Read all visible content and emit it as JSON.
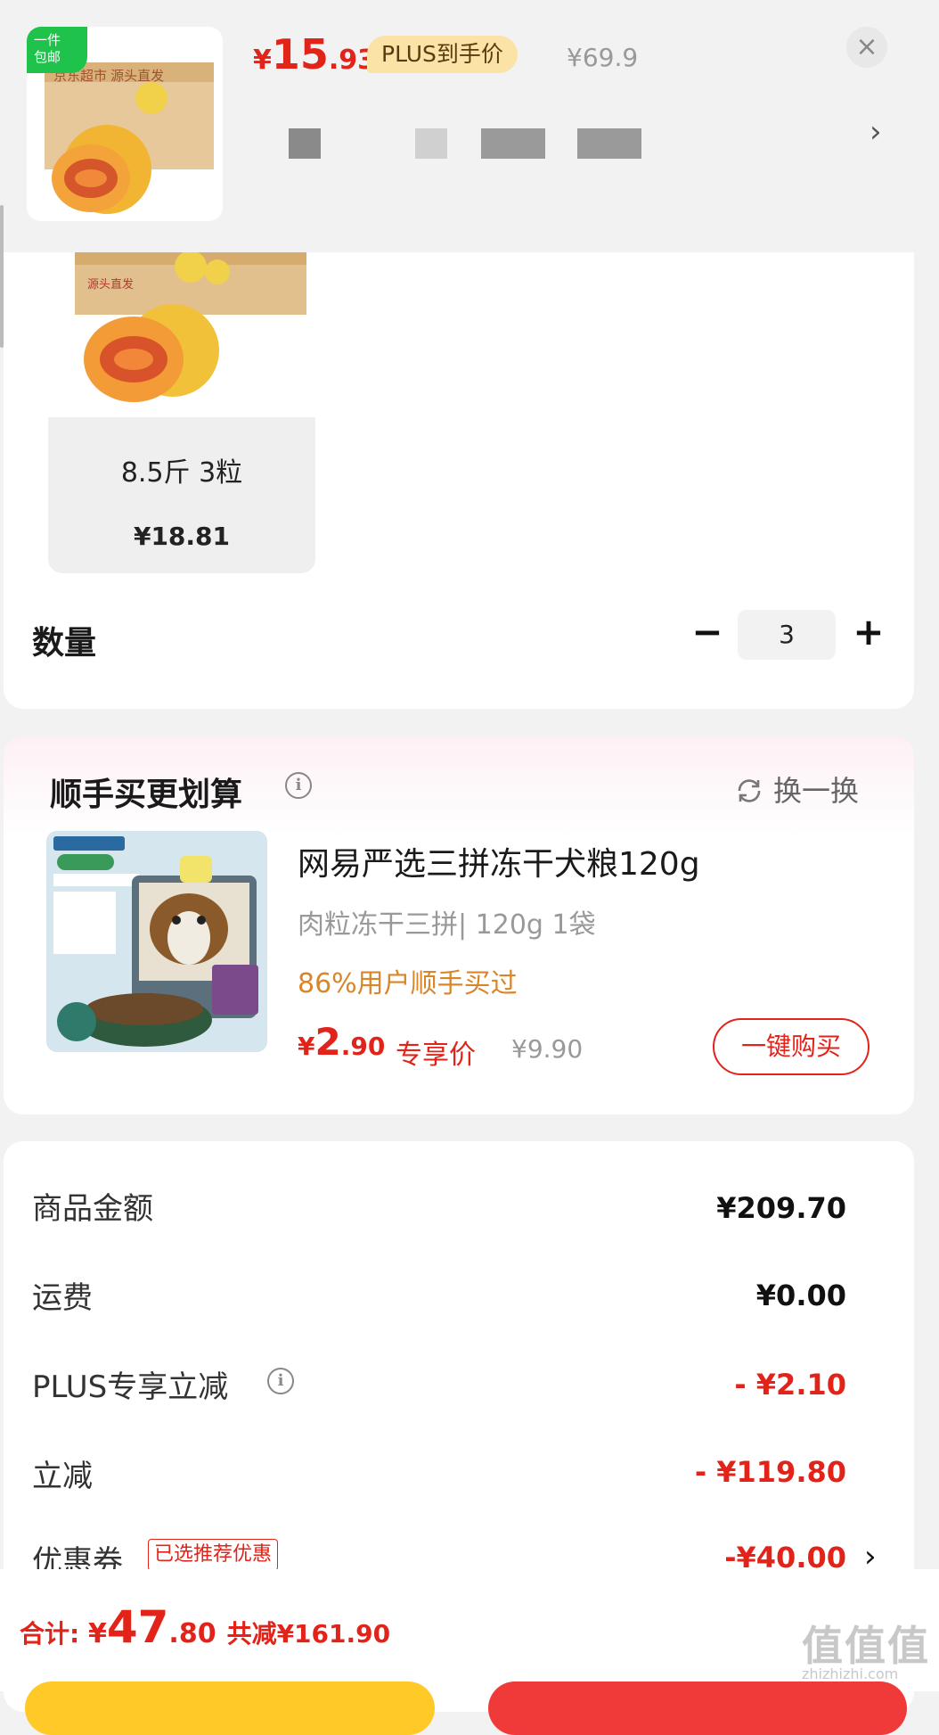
{
  "header": {
    "ribbon": "一件\n包邮",
    "price_currency": "¥",
    "price_int": "15",
    "price_dec": ".93",
    "plus_tag": "PLUS到手价",
    "original_price": "¥69.9",
    "close_icon": "×",
    "more_specs": "›"
  },
  "option": {
    "label": "8.5斤 3粒",
    "price": "¥18.81"
  },
  "quantity": {
    "label": "数量",
    "minus": "−",
    "value": "3",
    "plus": "+"
  },
  "recommend": {
    "title": "顺手买更划算",
    "info": "i",
    "swap": "换一换",
    "product_name": "网易严选三拼冻干犬粮120g",
    "product_spec": "肉粒冻干三拼| 120g 1袋",
    "bought_text": "86%用户顺手买过",
    "price_currency": "¥",
    "price_int": "2",
    "price_dec": ".90",
    "price_tag": "专享价",
    "original_price": "¥9.90",
    "buy_button": "一键购买"
  },
  "summary": {
    "goods_label": "商品金额",
    "goods_value": "¥209.70",
    "shipping_label": "运费",
    "shipping_value": "¥0.00",
    "plus_label": "PLUS专享立减",
    "plus_info": "i",
    "plus_value": "- ¥2.10",
    "discount_label": "立减",
    "discount_value": "- ¥119.80",
    "coupon_label": "优惠券",
    "coupon_chip": "已选推荐优惠",
    "coupon_value": "-¥40.00",
    "coupon_arrow": "›"
  },
  "footer": {
    "total_label": "合计: ",
    "total_currency": "¥",
    "total_int": "47",
    "total_dec": ".80",
    "saved_text": "共减¥161.90"
  },
  "watermark": {
    "main": "值值值",
    "sub": "zhizhizhi.com"
  },
  "colors": {
    "accent_red": "#e2231a",
    "plus_gold": "#fbe2a6",
    "bought_orange": "#d9862b",
    "primary_yellow": "#ffc928"
  }
}
